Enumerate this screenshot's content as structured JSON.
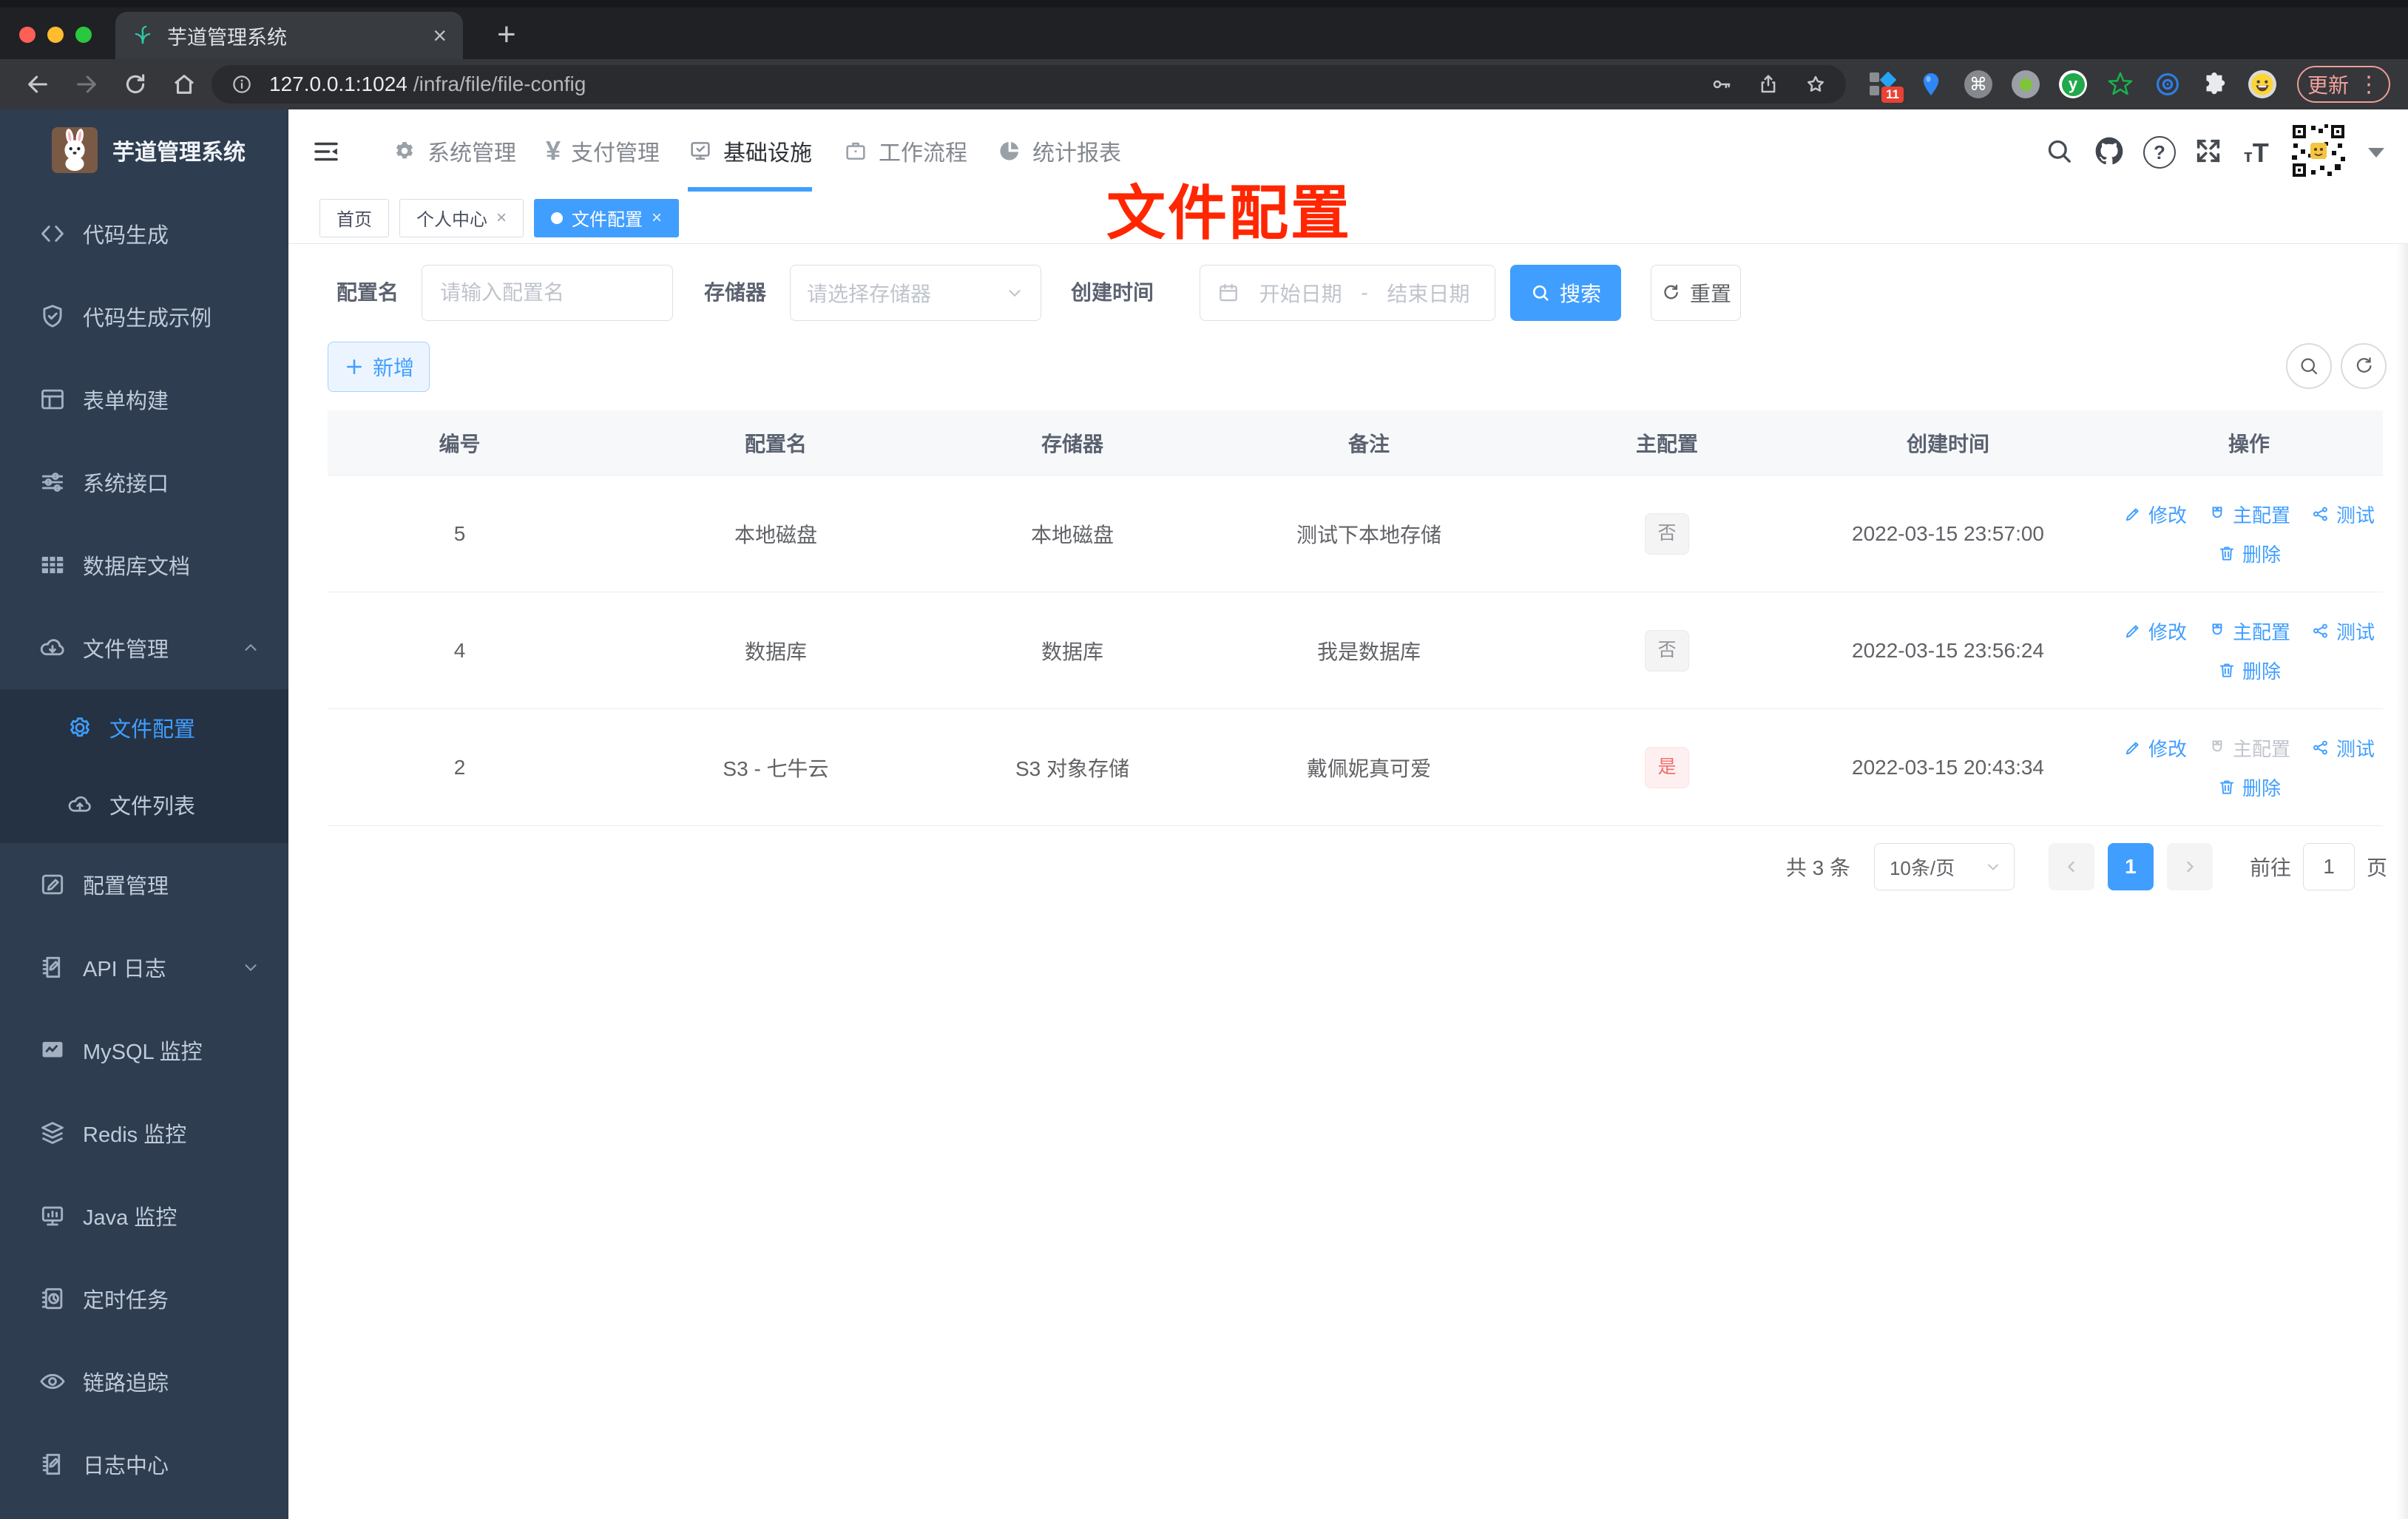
{
  "colors": {
    "accent": "#409eff",
    "danger": "#f56c6c",
    "sidebar_bg": "#2f3d50",
    "submenu_bg": "#253243",
    "annotation_red": "#ff2600",
    "tag_info_text": "#909399"
  },
  "browser": {
    "tab_title": "芋道管理系统",
    "url_host": "127.0.0.1:1024",
    "url_path": "/infra/file/file-config",
    "update_label": "更新",
    "menu_glyph": "⋮",
    "extensions_badge": "11",
    "cmd_glyph": "⌘",
    "y_glyph": "y"
  },
  "sidebar": {
    "title": "芋道管理系统",
    "items": [
      {
        "label": "代码生成"
      },
      {
        "label": "代码生成示例"
      },
      {
        "label": "表单构建"
      },
      {
        "label": "系统接口"
      },
      {
        "label": "数据库文档"
      },
      {
        "label": "文件管理"
      },
      {
        "label": "文件配置"
      },
      {
        "label": "文件列表"
      },
      {
        "label": "配置管理"
      },
      {
        "label": "API 日志"
      },
      {
        "label": "MySQL 监控"
      },
      {
        "label": "Redis 监控"
      },
      {
        "label": "Java 监控"
      },
      {
        "label": "定时任务"
      },
      {
        "label": "链路追踪"
      },
      {
        "label": "日志中心"
      }
    ]
  },
  "topnav": {
    "items": [
      {
        "label": "系统管理"
      },
      {
        "label": "支付管理"
      },
      {
        "label": "基础设施"
      },
      {
        "label": "工作流程"
      },
      {
        "label": "统计报表"
      }
    ]
  },
  "tags": {
    "tabs": [
      {
        "label": "首页"
      },
      {
        "label": "个人中心"
      },
      {
        "label": "文件配置"
      }
    ]
  },
  "annotation": {
    "text": "文件配置"
  },
  "filter": {
    "name_label": "配置名",
    "name_placeholder": "请输入配置名",
    "storage_label": "存储器",
    "storage_placeholder": "请选择存储器",
    "date_label": "创建时间",
    "date_start": "开始日期",
    "date_separator": "-",
    "date_end": "结束日期",
    "search_label": "搜索",
    "reset_label": "重置"
  },
  "toolbar": {
    "add_label": "新增"
  },
  "table": {
    "columns": [
      "编号",
      "配置名",
      "存储器",
      "备注",
      "主配置",
      "创建时间",
      "操作"
    ],
    "rows": [
      {
        "id": "5",
        "name": "本地磁盘",
        "storage": "本地磁盘",
        "remark": "测试下本地存储",
        "master": "否",
        "created": "2022-03-15 23:57:00"
      },
      {
        "id": "4",
        "name": "数据库",
        "storage": "数据库",
        "remark": "我是数据库",
        "master": "否",
        "created": "2022-03-15 23:56:24"
      },
      {
        "id": "2",
        "name": "S3 - 七牛云",
        "storage": "S3 对象存储",
        "remark": "戴佩妮真可爱",
        "master": "是",
        "created": "2022-03-15 20:43:34"
      }
    ],
    "actions": {
      "edit": "修改",
      "master": "主配置",
      "test": "测试",
      "remove": "删除"
    }
  },
  "pagination": {
    "total": "共 3 条",
    "page_size": "10条/页",
    "page": "1",
    "goto_label": "前往",
    "goto_value": "1",
    "unit_label": "页"
  }
}
